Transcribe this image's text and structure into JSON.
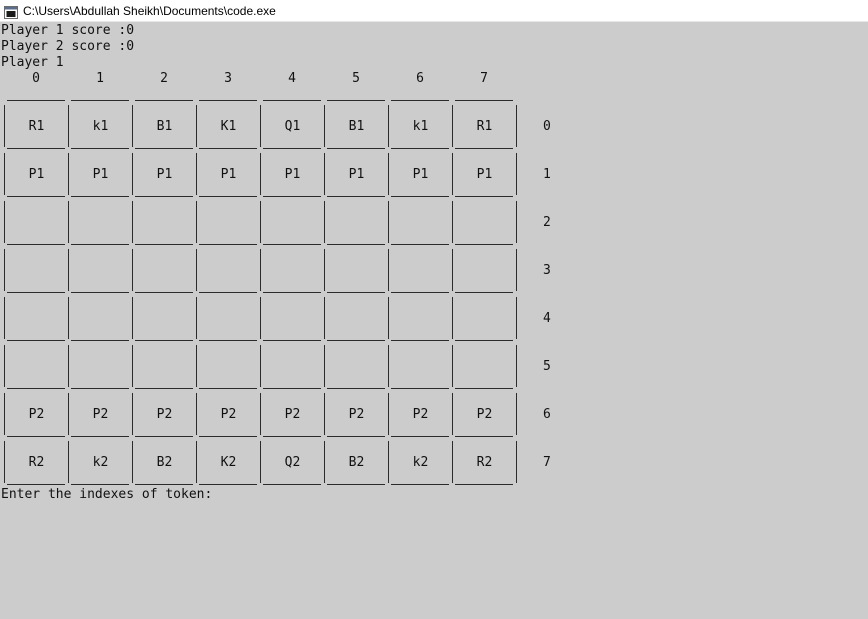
{
  "window": {
    "title": "C:\\Users\\Abdullah Sheikh\\Documents\\code.exe"
  },
  "console": {
    "player1_score": "Player 1 score :0",
    "player2_score": "Player 2 score :0",
    "current_player": "Player 1",
    "prompt": "Enter the indexes of token:"
  },
  "board": {
    "col_labels": [
      "0",
      "1",
      "2",
      "3",
      "4",
      "5",
      "6",
      "7"
    ],
    "row_labels": [
      "0",
      "1",
      "2",
      "3",
      "4",
      "5",
      "6",
      "7"
    ],
    "cells": [
      [
        "R1",
        "k1",
        "B1",
        "K1",
        "Q1",
        "B1",
        "k1",
        "R1"
      ],
      [
        "P1",
        "P1",
        "P1",
        "P1",
        "P1",
        "P1",
        "P1",
        "P1"
      ],
      [
        "",
        "",
        "",
        "",
        "",
        "",
        "",
        ""
      ],
      [
        "",
        "",
        "",
        "",
        "",
        "",
        "",
        ""
      ],
      [
        "",
        "",
        "",
        "",
        "",
        "",
        "",
        ""
      ],
      [
        "",
        "",
        "",
        "",
        "",
        "",
        "",
        ""
      ],
      [
        "P2",
        "P2",
        "P2",
        "P2",
        "P2",
        "P2",
        "P2",
        "P2"
      ],
      [
        "R2",
        "k2",
        "B2",
        "K2",
        "Q2",
        "B2",
        "k2",
        "R2"
      ]
    ]
  },
  "colors": {
    "background": "#cccccc",
    "titlebar": "#ffffff",
    "text": "#111111",
    "grid": "#2b2b2b"
  },
  "icons": {
    "app_icon": "console-window-icon"
  }
}
